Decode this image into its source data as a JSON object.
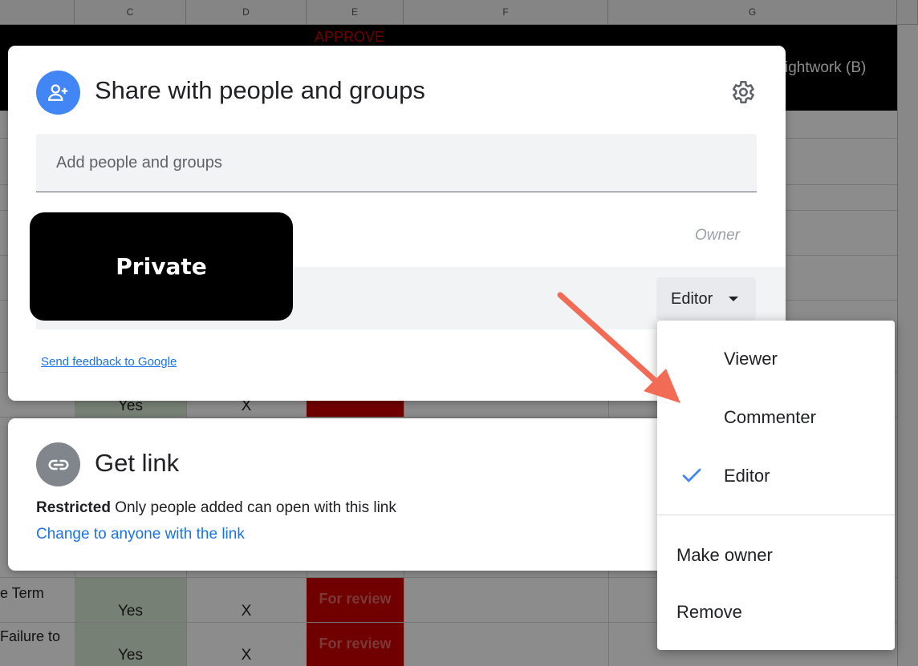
{
  "sheet": {
    "columns": [
      "C",
      "D",
      "E",
      "F",
      "G"
    ],
    "header_approve": "APPROVE",
    "header_right": "ightwork (B)",
    "rows": [
      {
        "left": "",
        "c": "Yes",
        "d": "X",
        "e": ""
      },
      {
        "left": "e Term",
        "c": "Yes",
        "d": "X",
        "e": "For review"
      },
      {
        "left": "Failure to",
        "c": "Yes",
        "d": "X",
        "e": "For review"
      }
    ]
  },
  "share_dialog": {
    "title": "Share with people and groups",
    "add_placeholder": "Add people and groups",
    "owner_label": "Owner",
    "role_button": "Editor",
    "redaction_label": "Private",
    "feedback_link": "Send feedback to Google"
  },
  "link_dialog": {
    "title": "Get link",
    "restricted_bold": "Restricted",
    "restricted_text": "Only people added can open with this link",
    "change_link": "Change to anyone with the link"
  },
  "role_menu": {
    "items": [
      {
        "label": "Viewer",
        "checked": false
      },
      {
        "label": "Commenter",
        "checked": false
      },
      {
        "label": "Editor",
        "checked": true
      },
      {
        "label": "Make owner",
        "checked": false
      },
      {
        "label": "Remove",
        "checked": false
      }
    ]
  },
  "colors": {
    "accent_blue": "#4285f4",
    "link_blue": "#1a73e8",
    "arrow": "#f26b55"
  },
  "icons": {
    "share": "person-add-icon",
    "settings": "gear-icon",
    "link": "link-icon",
    "check": "check-icon",
    "dropdown": "caret-down-icon"
  }
}
